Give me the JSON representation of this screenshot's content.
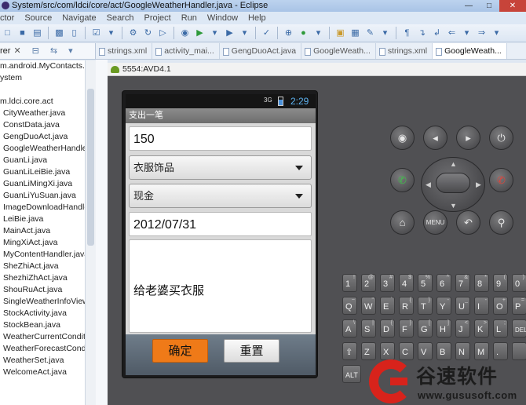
{
  "window": {
    "title": "System/src/com/ldci/core/act/GoogleWeatherHandler.java - Eclipse"
  },
  "menu": [
    "ctor",
    "Source",
    "Navigate",
    "Search",
    "Project",
    "Run",
    "Window",
    "Help"
  ],
  "explorer": {
    "tab_label": "rer",
    "rows": [
      "m.android.MyContacts.M",
      "ystem",
      "",
      "m.ldci.core.act",
      "CityWeather.java",
      "ConstData.java",
      "GengDuoAct.java",
      "GoogleWeatherHandle",
      "GuanLi.java",
      "GuanLiLeiBie.java",
      "GuanLiMingXi.java",
      "GuanLiYuSuan.java",
      "ImageDownloadHandle",
      "LeiBie.java",
      "MainAct.java",
      "MingXiAct.java",
      "MyContentHandler.java",
      "SheZhiAct.java",
      "ShezhiZhAct.java",
      "ShouRuAct.java",
      "SingleWeatherInfoView",
      "StockActivity.java",
      "StockBean.java",
      "WeatherCurrentConditi",
      "WeatherForecastCondit",
      "WeatherSet.java",
      "WelcomeAct.java"
    ]
  },
  "editor_tabs": [
    {
      "label": "strings.xml",
      "active": false
    },
    {
      "label": "activity_mai...",
      "active": false
    },
    {
      "label": "GengDuoAct.java",
      "active": false
    },
    {
      "label": "GoogleWeath...",
      "active": false
    },
    {
      "label": "strings.xml",
      "active": false
    },
    {
      "label": "GoogleWeath...",
      "active": true
    }
  ],
  "emulator": {
    "title": "5554:AVD4.1",
    "status": {
      "signal": "3G",
      "time": "2:29"
    },
    "app": {
      "title": "支出一笔",
      "amount": "150",
      "category": "衣服饰品",
      "account": "现金",
      "date": "2012/07/31",
      "note": "给老婆买衣服",
      "confirm_label": "确定",
      "reset_label": "重置"
    },
    "hw_buttons": {
      "row1": [
        "camera-icon",
        "volume-down-icon",
        "volume-up-icon",
        "power-icon"
      ],
      "call": "call-icon",
      "end_call": "end-call-icon",
      "row3": [
        "home-icon",
        "MENU",
        "back-icon",
        "search-icon"
      ]
    },
    "keyboard": {
      "row1": [
        [
          "1",
          "!"
        ],
        [
          "2",
          "@"
        ],
        [
          "3",
          "#"
        ],
        [
          "4",
          "$"
        ],
        [
          "5",
          "%"
        ],
        [
          "6",
          "^"
        ],
        [
          "7",
          "&"
        ],
        [
          "8",
          "*"
        ],
        [
          "9",
          "("
        ],
        [
          "0",
          ")"
        ]
      ],
      "row2": [
        [
          "Q",
          "~"
        ],
        [
          "W",
          "\""
        ],
        [
          "E",
          "`"
        ],
        [
          "R",
          "{"
        ],
        [
          "T",
          "}"
        ],
        [
          "Y",
          "-"
        ],
        [
          "U",
          "_"
        ],
        [
          "I",
          "-"
        ],
        [
          "O",
          "+"
        ],
        [
          "P",
          "="
        ]
      ],
      "row3": [
        [
          "A",
          "\\"
        ],
        [
          "S",
          "|"
        ],
        [
          "D",
          "{"
        ],
        [
          "F",
          "}"
        ],
        [
          "G",
          "["
        ],
        [
          "H",
          "]"
        ],
        [
          "J",
          "<"
        ],
        [
          "K",
          ">"
        ],
        [
          "L",
          ";"
        ],
        [
          "DEL",
          ""
        ]
      ],
      "row4": [
        [
          "⇧",
          ""
        ],
        [
          "Z",
          ""
        ],
        [
          "X",
          ""
        ],
        [
          "C",
          ""
        ],
        [
          "V",
          ""
        ],
        [
          "B",
          ""
        ],
        [
          "N",
          ""
        ],
        [
          "M",
          ""
        ],
        [
          ".",
          ""
        ],
        [
          "",
          ""
        ]
      ],
      "alt_label": "ALT"
    }
  },
  "watermark": {
    "brand": "谷速软件",
    "url": "www.gususoft.com"
  }
}
